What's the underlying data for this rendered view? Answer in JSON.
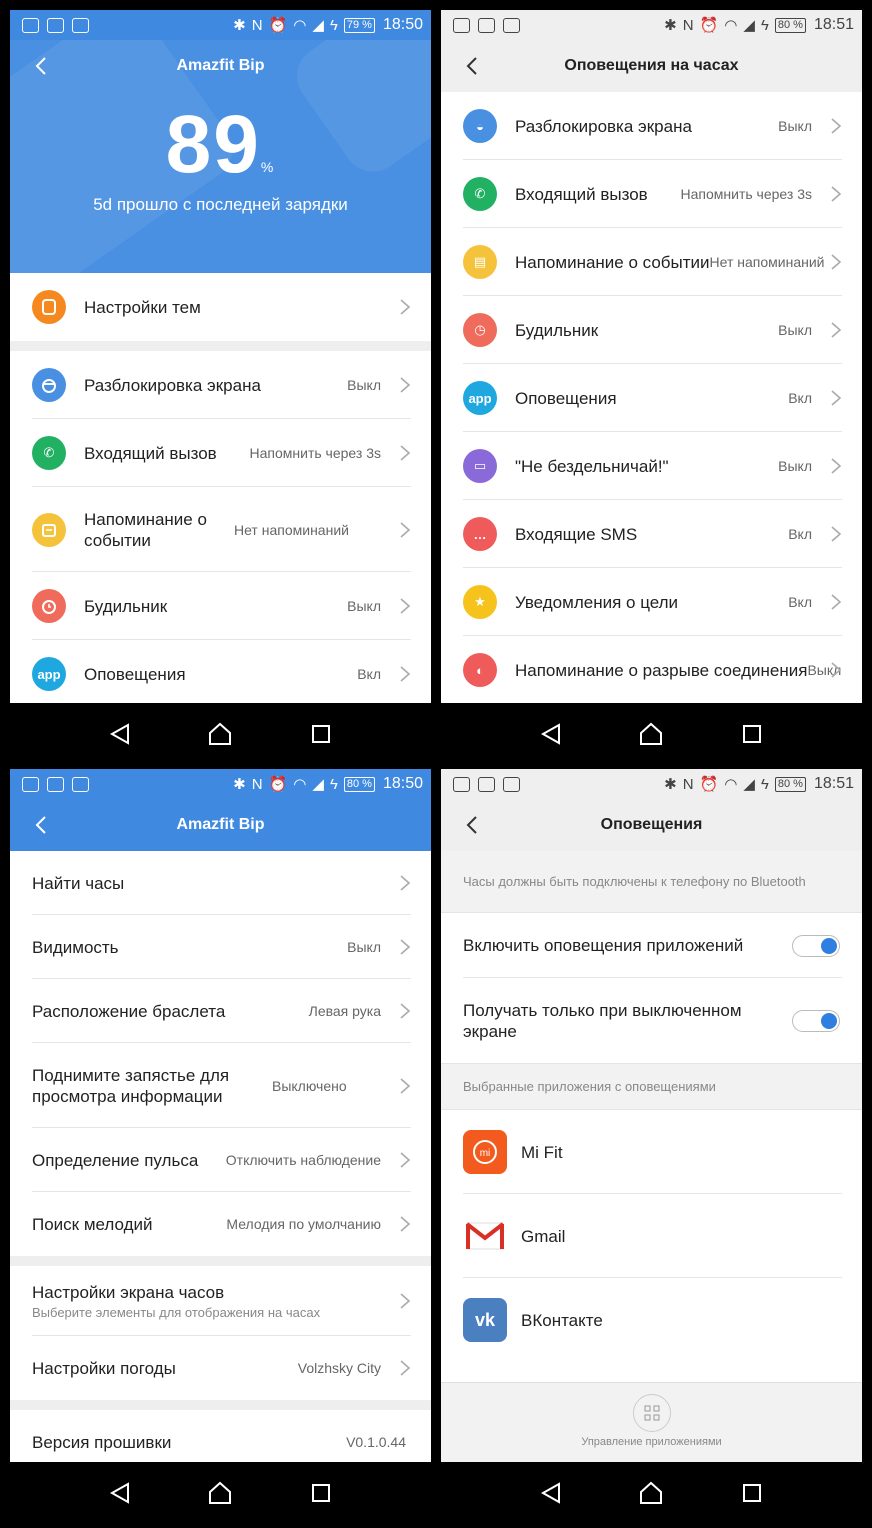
{
  "status": {
    "s1": {
      "battery": "79 %",
      "time": "18:50"
    },
    "s2": {
      "battery": "80 %",
      "time": "18:51"
    },
    "s3": {
      "battery": "80 %",
      "time": "18:50"
    },
    "s4": {
      "battery": "80 %",
      "time": "18:51"
    }
  },
  "screen1": {
    "title": "Amazfit Bip",
    "battery_value": "89",
    "battery_unit": "%",
    "since_charge": "5d прошло с последней зарядки",
    "theme_settings": "Настройки тем",
    "rows": [
      {
        "label": "Разблокировка экрана",
        "value": "Выкл"
      },
      {
        "label": "Входящий вызов",
        "value": "Напомнить через 3s"
      },
      {
        "label": "Напоминание о событии",
        "value": "Нет напоминаний"
      },
      {
        "label": "Будильник",
        "value": "Выкл"
      },
      {
        "label": "Оповещения",
        "value": "Вкл"
      }
    ],
    "app_icon_text": "app"
  },
  "screen2": {
    "title": "Оповещения на часах",
    "rows": [
      {
        "label": "Разблокировка экрана",
        "value": "Выкл"
      },
      {
        "label": "Входящий вызов",
        "value": "Напомнить через 3s"
      },
      {
        "label": "Напоминание о событии",
        "value": "Нет напоминаний"
      },
      {
        "label": "Будильник",
        "value": "Выкл"
      },
      {
        "label": "Оповещения",
        "value": "Вкл"
      },
      {
        "label": "\"Не бездельничай!\"",
        "value": "Выкл"
      },
      {
        "label": "Входящие SMS",
        "value": "Вкл"
      },
      {
        "label": "Уведомления о цели",
        "value": "Вкл"
      },
      {
        "label": "Напоминание о разрыве соединения",
        "value": "Выкл"
      }
    ],
    "app_icon_text": "app"
  },
  "screen3": {
    "title": "Amazfit Bip",
    "rows_a": [
      {
        "label": "Найти часы",
        "value": ""
      },
      {
        "label": "Видимость",
        "value": "Выкл"
      },
      {
        "label": "Расположение браслета",
        "value": "Левая рука"
      },
      {
        "label": "Поднимите запястье для просмотра информации",
        "value": "Выключено"
      },
      {
        "label": "Определение пульса",
        "value": "Отключить наблюдение"
      },
      {
        "label": "Поиск мелодий",
        "value": "Мелодия по умолчанию"
      }
    ],
    "watch_screen": {
      "label": "Настройки экрана часов",
      "sub": "Выберите элементы для отображения на часах"
    },
    "weather": {
      "label": "Настройки погоды",
      "value": "Volzhsky City"
    },
    "firmware": {
      "label": "Версия прошивки",
      "value": "V0.1.0.44"
    }
  },
  "screen4": {
    "title": "Оповещения",
    "note": "Часы должны быть подключены к телефону по Bluetooth",
    "toggles": [
      {
        "label": "Включить оповещения приложений",
        "on": true
      },
      {
        "label": "Получать только при выключенном экране",
        "on": true
      }
    ],
    "selected_head": "Выбранные приложения с оповещениями",
    "apps": [
      {
        "name": "Mi Fit",
        "icon": "mi-fit-icon"
      },
      {
        "name": "Gmail",
        "icon": "gmail-icon"
      },
      {
        "name": "ВКонтакте",
        "icon": "vk-icon"
      }
    ],
    "manage_apps": "Управление приложениями",
    "mi_text": "mi",
    "vk_text": "vk"
  },
  "colors": {
    "blue_header": "#3f8ae0",
    "unlock": "#4a90e2",
    "call": "#22b163",
    "event": "#f5c33b",
    "alarm": "#ef6b5b",
    "app": "#1fa8e0",
    "idle": "#8a6ad8",
    "sms": "#ef5b5b",
    "goal": "#f5c31b",
    "disconnect": "#ef5b5b",
    "theme": "#f5891f"
  }
}
